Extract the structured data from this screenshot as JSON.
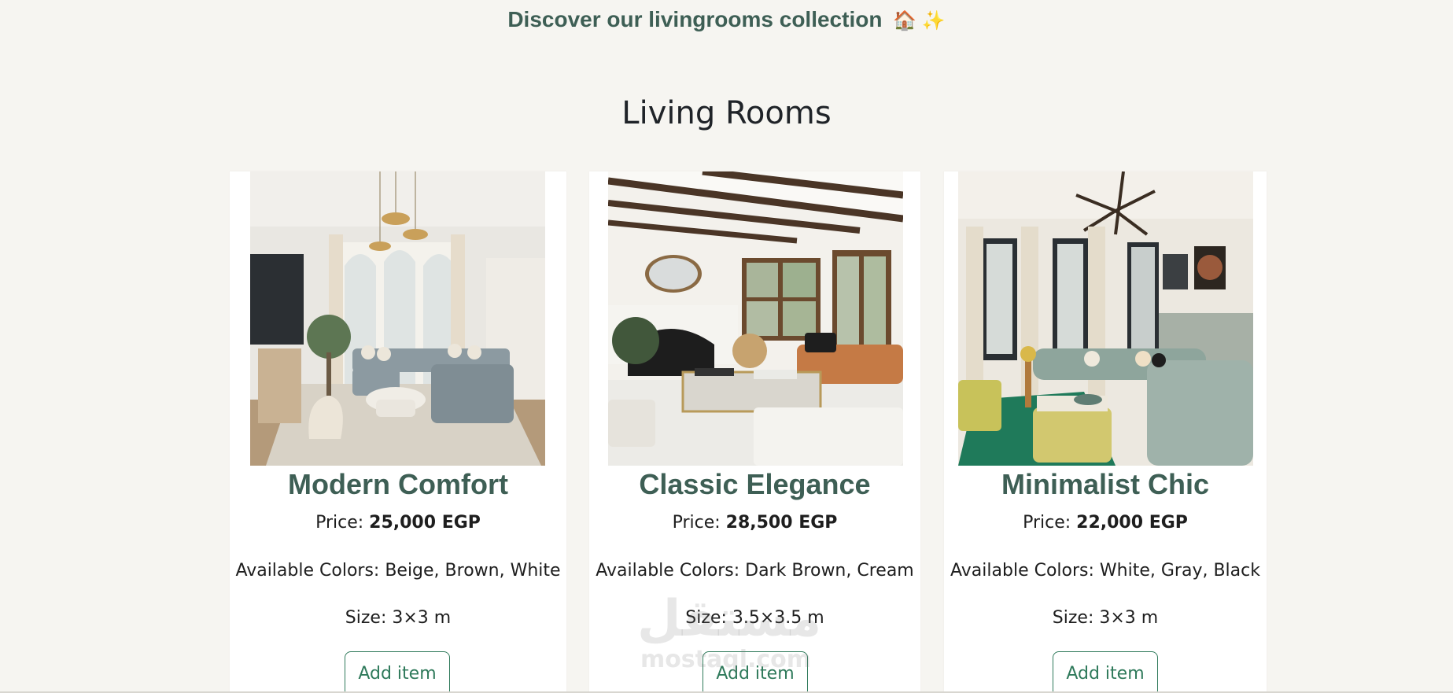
{
  "banner": {
    "text": "Discover our livingrooms collection",
    "emoji": "🏠 ✨"
  },
  "section_title": "Living Rooms",
  "products": [
    {
      "name": "Modern Comfort",
      "price_label": "Price:",
      "price_value": "25,000 EGP",
      "colors": "Available Colors: Beige, Brown, White",
      "size": "Size: 3×3 m",
      "button": "Add item"
    },
    {
      "name": "Classic Elegance",
      "price_label": "Price:",
      "price_value": "28,500 EGP",
      "colors": "Available Colors: Dark Brown, Cream",
      "size": "Size: 3.5×3.5 m",
      "button": "Add item"
    },
    {
      "name": "Minimalist Chic",
      "price_label": "Price:",
      "price_value": "22,000 EGP",
      "colors": "Available Colors: White, Gray, Black",
      "size": "Size: 3×3 m",
      "button": "Add item"
    }
  ],
  "watermark": {
    "arabic": "مستقل",
    "latin": "mostaql.com"
  },
  "colors": {
    "accent": "#3e5f55",
    "button": "#2f7a5b",
    "background": "#f6f5f1"
  }
}
